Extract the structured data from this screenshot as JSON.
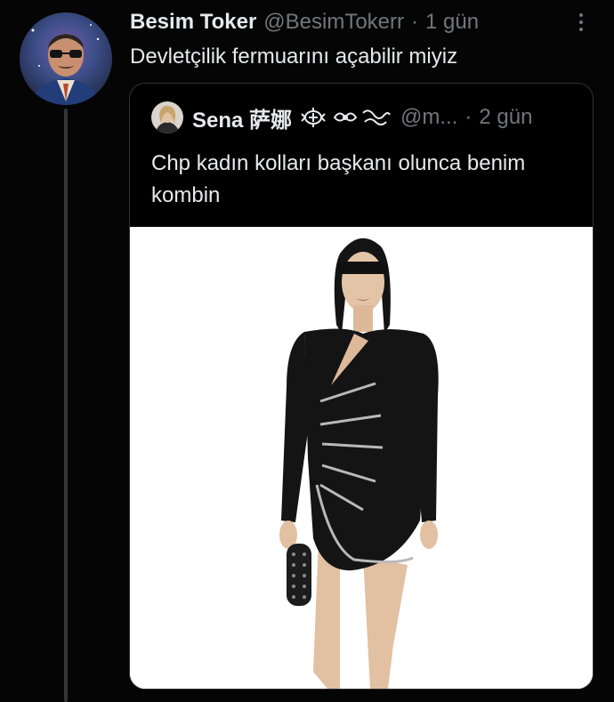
{
  "tweet": {
    "author_name": "Besim Toker",
    "author_handle": "@BesimTokerr",
    "separator": "·",
    "time": "1 gün",
    "text": "Devletçilik fermuarını açabilir miyiz"
  },
  "quoted_tweet": {
    "author_name": "Sena 萨娜",
    "author_handle": "@m...",
    "separator": "·",
    "time": "2 gün",
    "text": "Chp kadın kolları başkanı olunca benim kombin"
  },
  "icons": {
    "avatar": "avatar",
    "more": "more-options-icon",
    "decoration": "name-decoration-icon",
    "media": "tweet-media-image"
  },
  "colors": {
    "background": "#050505",
    "text": "#e7e9ea",
    "muted": "#71767b",
    "border": "#2f3336"
  }
}
